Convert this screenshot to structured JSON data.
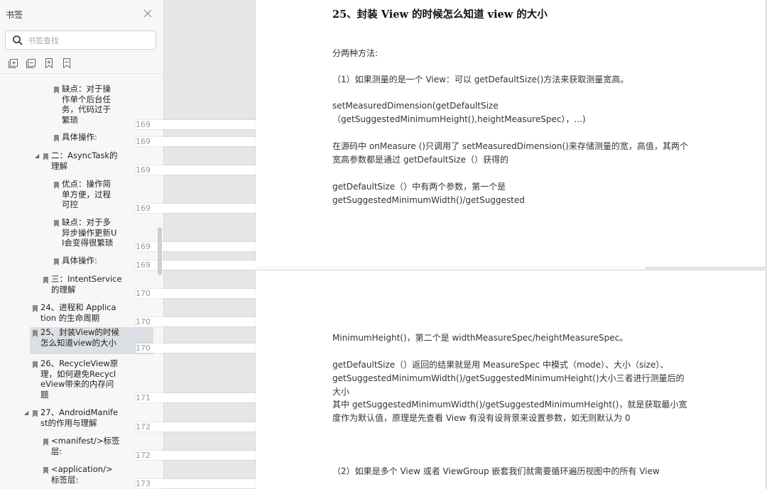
{
  "sidebar": {
    "title": "书签",
    "search_placeholder": "书签查找",
    "items": [
      {
        "label": "缺点：对于操作单个后台任务，代码过于繁琐",
        "lines": [
          "缺点：对于操",
          "作单个后台任",
          "务，代码过于",
          "繁琐"
        ],
        "page": "169"
      },
      {
        "label": "具体操作:",
        "lines": [
          "具体操作:"
        ],
        "page": "169"
      },
      {
        "label": "二：AsyncTask的理解",
        "lines": [
          "二：AsyncTask的",
          "理解"
        ],
        "page": "169"
      },
      {
        "label": "优点：操作简单方便，过程可控",
        "lines": [
          "优点：操作简",
          "单方便，过程",
          "可控"
        ],
        "page": "169"
      },
      {
        "label": "缺点：对于多异步操作更新UI会变得很繁琐",
        "lines": [
          "缺点：对于多",
          "异步操作更新U",
          "I会变得很繁琐"
        ],
        "page": "169"
      },
      {
        "label": "具体操作:",
        "lines": [
          "具体操作:"
        ],
        "page": "169"
      },
      {
        "label": "三：IntentService的理解",
        "lines": [
          "三：IntentService",
          "的理解"
        ],
        "page": "170"
      },
      {
        "label": "24、进程和 Application 的生命周期",
        "lines": [
          "24、进程和 Applica",
          "tion 的生命周期"
        ],
        "page": "170"
      },
      {
        "label": "25、封装View的时候怎么知道view的大小",
        "lines": [
          "25、封装View的时候",
          "怎么知道view的大小"
        ],
        "page": "170"
      },
      {
        "label": "26、RecycleView原理，如何避免RecycleView带来的内存问题",
        "lines": [
          "26、RecycleView原",
          "理，如何避免Recycl",
          "eView带来的内存问",
          "题"
        ],
        "page": "171"
      },
      {
        "label": "27、AndroidManifest的作用与理解",
        "lines": [
          "27、AndroidManife",
          "st的作用与理解"
        ],
        "page": "172"
      },
      {
        "label": "<manifest/>标签层:",
        "lines": [
          "<manifest/>标签",
          "层:"
        ],
        "page": "172"
      },
      {
        "label": "<application/>标签层:",
        "lines": [
          "<application/>",
          "标签层:"
        ],
        "page": "173"
      }
    ]
  },
  "document": {
    "page1": {
      "heading": "25、封装 View 的时候怎么知道 view 的大小",
      "paragraphs": [
        "分两种方法:",
        "（1）如果测量的是一个 View：可以 getDefaultSize()方法来获取测量宽高。",
        "setMeasuredDimension(getDefaultSize（getSuggestedMinimumHeight(),heightMeasureSpec），...)",
        "在源码中 onMeasure ()只调用了 setMeasuredDimension()来存储测量的宽，高值，其两个宽高参数都是通过 getDefaultSize（）获得的",
        "getDefaultSize（）中有两个参数，第一个是 getSuggestedMinimumWidth()/getSuggested"
      ]
    },
    "page2": {
      "paragraphs": [
        "MinimumHeight()，第二个是 widthMeasureSpec/heightMeasureSpec。",
        "getDefaultSize（）返回的结果就是用 MeasureSpec 中模式（mode）、大小（size）、getSuggestedMinimumWidth()/getSuggestedMinimumHeight()大小三者进行测量后的大小",
        "其中 getSuggestedMinimumWidth()/getSuggestedMinimumHeight()，就是获取最小宽度作为默认值，原理是先查看 View 有没有设背景来设置参数，如无则默认为 0",
        "（2）如果是多个 View 或者 ViewGroup 嵌套我们就需要循环遍历视图中的所有 View"
      ]
    }
  }
}
